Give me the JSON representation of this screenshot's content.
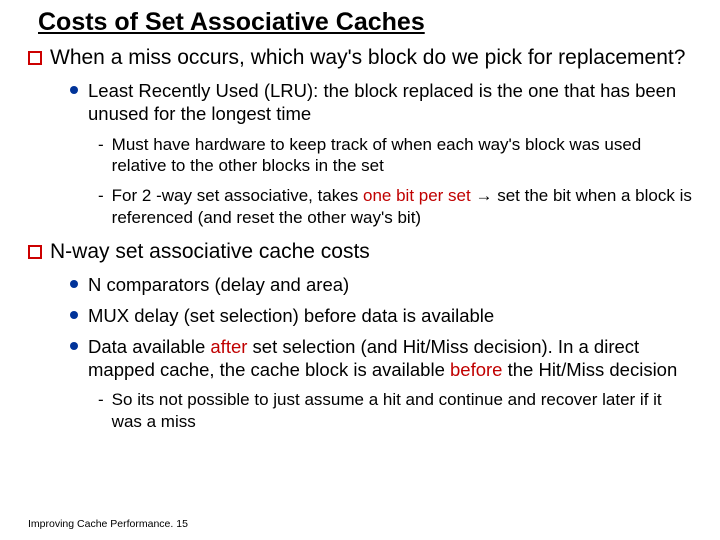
{
  "title": "Costs of Set Associative Caches",
  "q1": {
    "text": "When a miss occurs, which way's block do we pick for replacement?"
  },
  "q1_b1": {
    "text": "Least Recently Used (LRU): the block replaced is the one that has been unused for the longest time"
  },
  "q1_b1_d1": {
    "text": "Must have hardware to keep track of when each way's block was used relative to the other blocks in the set"
  },
  "q1_b1_d2": {
    "pre": "For 2 -way set associative, takes ",
    "red": "one bit per set",
    "post": " → set the bit when a block is referenced (and reset the other way's bit)"
  },
  "q2": {
    "text": "N-way set associative cache costs"
  },
  "q2_b1": {
    "text": "N comparators (delay and area)"
  },
  "q2_b2": {
    "text": "MUX delay (set selection) before data is available"
  },
  "q2_b3": {
    "p1": "Data available ",
    "r1": "after",
    "p2": " set selection (and Hit/Miss decision).   In a direct mapped cache, the cache block is available ",
    "r2": "before",
    "p3": " the Hit/Miss decision"
  },
  "q2_b3_d1": {
    "text": "So its not possible to just assume a hit and continue and recover later if it was a miss"
  },
  "footer": "Improving Cache Performance. 15"
}
